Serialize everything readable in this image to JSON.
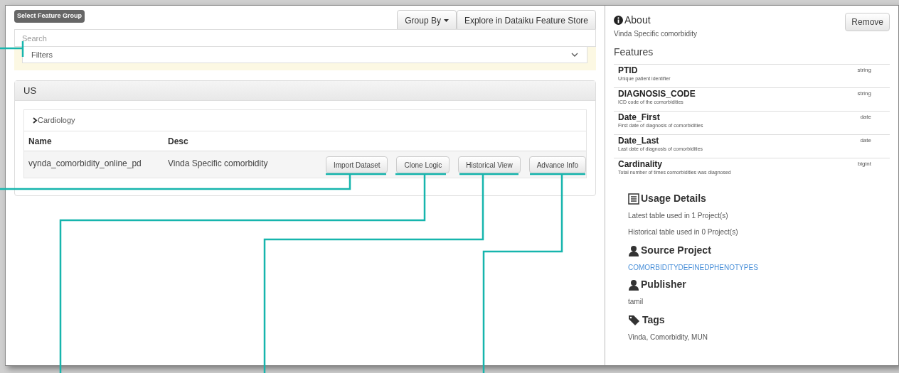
{
  "header": {
    "badge": "Select Feature Group",
    "buttons": [
      {
        "label": "Group By",
        "kind": "dropdown"
      },
      {
        "label": "Explore in Dataiku Feature Store",
        "kind": "plain"
      }
    ]
  },
  "search": {
    "placeholder": "Search"
  },
  "filters": {
    "label": "Filters",
    "expanded": false
  },
  "group": {
    "title": "US",
    "category": {
      "label": "Cardiology",
      "expanded": false
    },
    "columns": [
      "Name",
      "Desc"
    ],
    "rows": [
      {
        "name": "vynda_comorbidity_online_pd",
        "desc": "Vinda Specific comorbidity",
        "actions": [
          "Import Dataset",
          "Clone Logic",
          "Historical View",
          "Advance Info"
        ]
      }
    ]
  },
  "details": {
    "about_title": "About",
    "remove_button": "Remove",
    "about_text": "Vinda Specific comorbidity",
    "features_title": "Features",
    "features": [
      {
        "name": "PTID",
        "description": "Unique patient identifier",
        "type": "string"
      },
      {
        "name": "DIAGNOSIS_CODE",
        "description": "ICD code of the comorbidities",
        "type": "string"
      },
      {
        "name": "Date_First",
        "description": "First date of diagnosis of comorbidities",
        "type": "date"
      },
      {
        "name": "Date_Last",
        "description": "Last date of diagnosis of comorbidities",
        "type": "date"
      },
      {
        "name": "Cardinality",
        "description": "Total number of times comorbidities was diagnosed",
        "type": "bigint"
      }
    ],
    "sections": [
      {
        "kind": "usage",
        "title": "Usage Details",
        "lines": [
          "Latest table used in 1 Project(s)",
          "Historical table used in 0 Project(s)"
        ]
      },
      {
        "kind": "source",
        "title": "Source Project",
        "link": "COMORBIDITYDEFINEDPHENOTYPES"
      },
      {
        "kind": "publisher",
        "title": "Publisher",
        "lines": [
          "tamil"
        ]
      },
      {
        "kind": "tags",
        "title": "Tags",
        "lines": [
          "Vinda, Comorbidity, MUN"
        ]
      }
    ]
  }
}
